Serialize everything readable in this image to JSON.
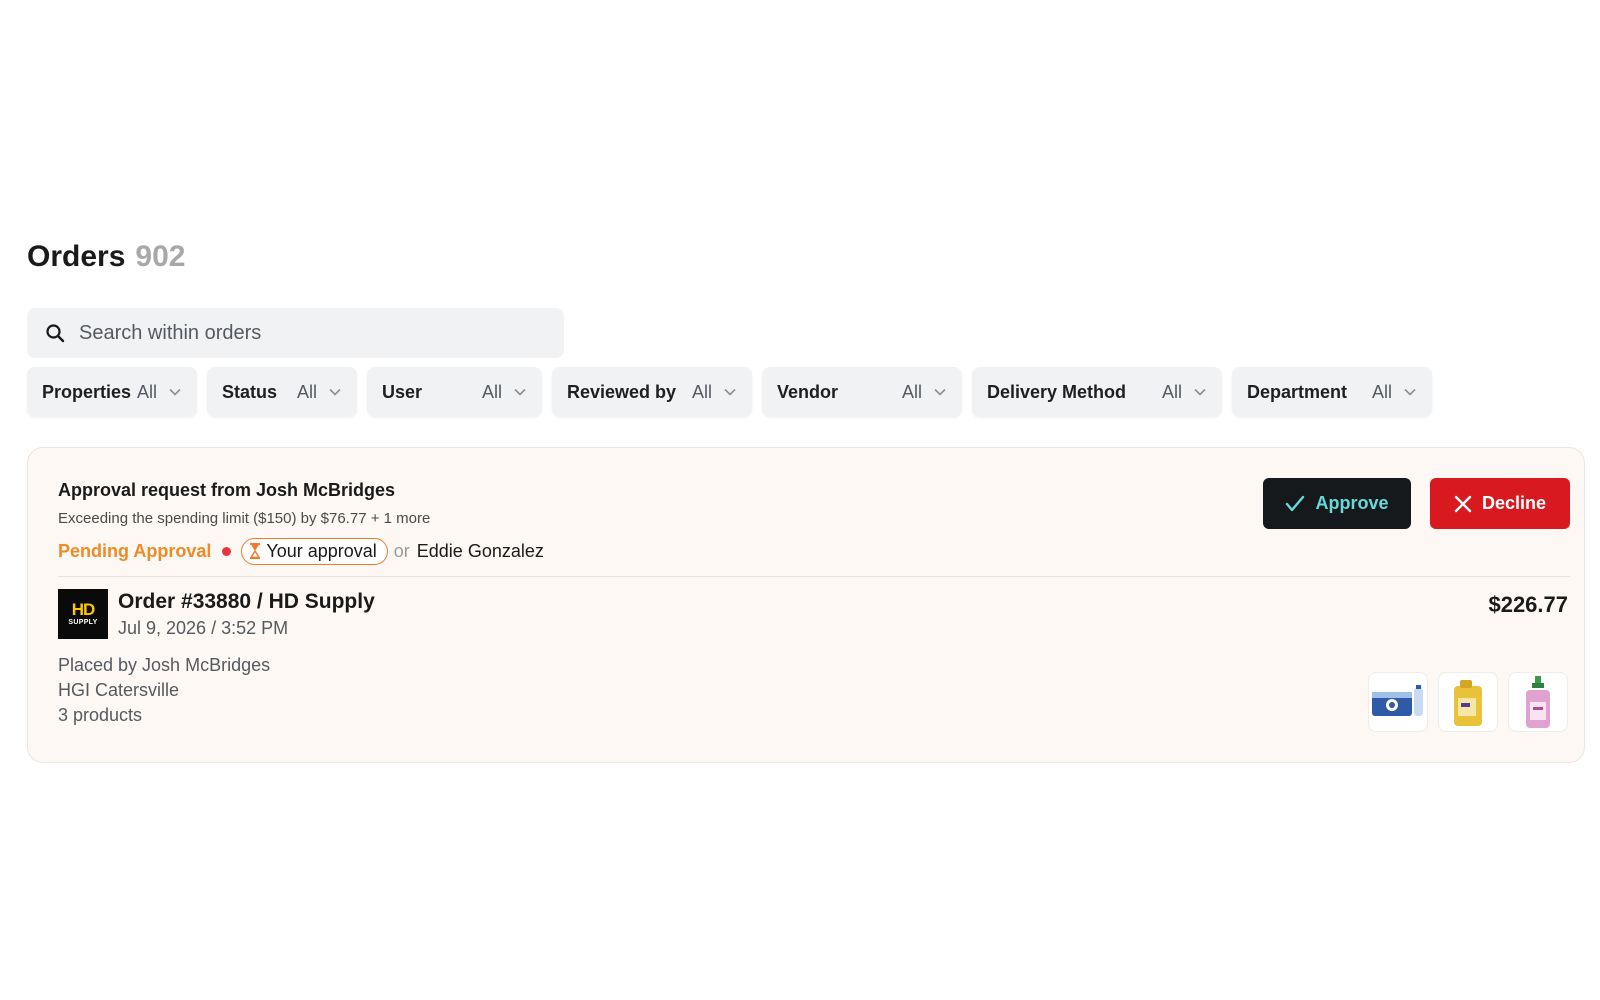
{
  "header": {
    "title": "Orders",
    "count": "902"
  },
  "search": {
    "placeholder": "Search within orders",
    "value": "",
    "icon": "search-icon"
  },
  "filters": [
    {
      "label": "Properties",
      "value": "All"
    },
    {
      "label": "Status",
      "value": "All"
    },
    {
      "label": "User",
      "value": "All"
    },
    {
      "label": "Reviewed by",
      "value": "All"
    },
    {
      "label": "Vendor",
      "value": "All"
    },
    {
      "label": "Delivery Method",
      "value": "All"
    },
    {
      "label": "Department",
      "value": "All"
    }
  ],
  "approval": {
    "title": "Approval request from Josh McBridges",
    "subtitle": "Exceeding the spending limit ($150) by $76.77 + 1 more",
    "status": "Pending Approval",
    "your_approval": "Your approval",
    "or": "or",
    "other_approver": "Eddie Gonzalez",
    "approve_label": "Approve",
    "decline_label": "Decline",
    "colors": {
      "pending": "#f08a24",
      "dot": "#e8343e",
      "approve_bg": "#15191c",
      "approve_text": "#68d9d9",
      "decline_bg": "#d8191f"
    }
  },
  "order": {
    "vendor_logo": {
      "line1": "HD",
      "line2": "SUPPLY"
    },
    "title": "Order #33880 / HD Supply",
    "date": "Jul 9, 2026 / 3:52 PM",
    "total": "$226.77",
    "placed_by": "Placed by Josh McBridges",
    "property": "HGI Catersville",
    "products": "3 products",
    "thumbnails": [
      "water-bottles-pack-image",
      "yellow-cleaner-jug-image",
      "pink-soap-bottle-image"
    ]
  }
}
